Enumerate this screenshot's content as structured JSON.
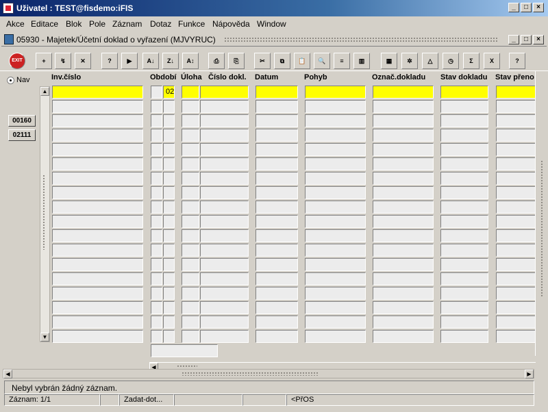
{
  "window": {
    "title": "Uživatel : TEST@fisdemo:iFIS",
    "buttons": [
      "_",
      "□",
      "×"
    ]
  },
  "menu": [
    "Akce",
    "Editace",
    "Blok",
    "Pole",
    "Záznam",
    "Dotaz",
    "Funkce",
    "Nápověda",
    "Window"
  ],
  "form": {
    "title": "05930 - Majetek/Účetní doklad o vyřazení (MJVYRUC)",
    "buttons": [
      "_",
      "□",
      "×"
    ]
  },
  "toolbar": {
    "icons": [
      "exit-icon",
      "insert-record-icon",
      "save-icon",
      "delete-record-icon",
      "enter-query-icon",
      "execute-query-icon",
      "sort-asc-icon",
      "sort-desc-icon",
      "sort-multi-icon",
      "print-icon",
      "print-preview-icon",
      "cut-icon",
      "copy-icon",
      "paste-icon",
      "find-icon",
      "list-icon",
      "columns-icon",
      "calendar-icon",
      "settings-icon",
      "filter-icon",
      "clock-icon",
      "sum-icon",
      "excel-icon",
      "help-icon"
    ],
    "labels": [
      "EXIT",
      "+",
      "↯",
      "✕",
      "?",
      "▶",
      "A↓",
      "Z↓",
      "A↕",
      "⎙",
      "⎘",
      "✂",
      "⧉",
      "📋",
      "🔍",
      "≡",
      "▥",
      "▦",
      "✲",
      "△",
      "◷",
      "Σ",
      "X",
      "?"
    ]
  },
  "nav": {
    "radio_label": "Nav",
    "buttons": [
      "00160",
      "02111"
    ]
  },
  "columns": [
    "Inv.číslo",
    "Období",
    "Úloha",
    "Číslo dokl.",
    "Datum",
    "Pohyb",
    "Označ.dokladu",
    "Stav dokladu",
    "Stav přeno"
  ],
  "first_row": {
    "obdobi_value": "02"
  },
  "row_count": 18,
  "status": {
    "message": "Nebyl vybrán žádný záznam.",
    "record": "Záznam: 1/1",
    "mode": "Zadat-dot...",
    "insert": "<PřOS"
  },
  "colors": {
    "highlight": "#ffff00",
    "titlebar": "#0a246a",
    "background": "#d4d0c8"
  }
}
